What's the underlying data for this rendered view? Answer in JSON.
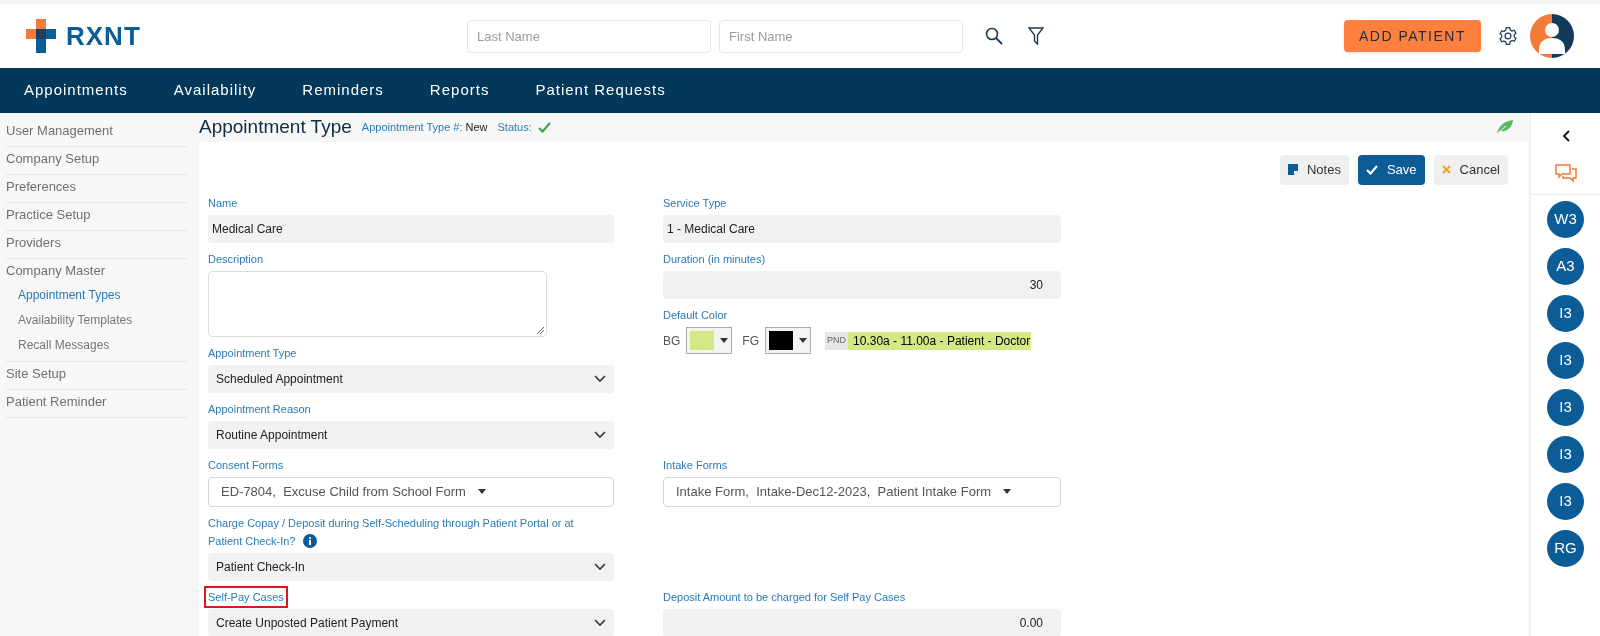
{
  "header": {
    "logo_text": "RXNT",
    "search_fields": [
      {
        "placeholder": "Last Name"
      },
      {
        "placeholder": "First Name"
      }
    ],
    "add_button": "ADD PATIENT"
  },
  "nav": [
    {
      "label": "Appointments"
    },
    {
      "label": "Availability"
    },
    {
      "label": "Reminders"
    },
    {
      "label": "Reports"
    },
    {
      "label": "Patient Requests"
    }
  ],
  "sidebar": [
    {
      "label": "User Management",
      "selected": false
    },
    {
      "label": "Company Setup",
      "selected": false
    },
    {
      "label": "Preferences",
      "selected": false
    },
    {
      "label": "Practice Setup",
      "selected": false
    },
    {
      "label": "Providers",
      "selected": false
    },
    {
      "label": "Company Master",
      "selected": false,
      "children": [
        {
          "label": "Appointment Types",
          "selected": true
        },
        {
          "label": "Availability Templates",
          "selected": false
        },
        {
          "label": "Recall Messages",
          "selected": false
        }
      ]
    },
    {
      "label": "Site Setup",
      "selected": false
    },
    {
      "label": "Patient Reminder",
      "selected": false
    }
  ],
  "page": {
    "title": "Appointment Type",
    "number_label": "Appointment Type #:",
    "number_value": "New",
    "status_label": "Status:"
  },
  "actions": [
    {
      "kind": "notes",
      "label": "Notes"
    },
    {
      "kind": "save",
      "label": "Save"
    },
    {
      "kind": "cancel",
      "label": "Cancel"
    }
  ],
  "left_fields": [
    {
      "kind": "text",
      "label": "Name",
      "value": "Medical Care",
      "highlighted": false,
      "info": false
    },
    {
      "kind": "textarea",
      "label": "Description",
      "highlighted": false,
      "info": false
    },
    {
      "kind": "select",
      "label": "Appointment Type",
      "value": "Scheduled Appointment",
      "highlighted": false,
      "info": false
    },
    {
      "kind": "select",
      "label": "Appointment Reason",
      "value": "Routine Appointment",
      "highlighted": false,
      "info": false
    },
    {
      "kind": "multiselect",
      "label": "Consent Forms",
      "value": "ED-7804,  Excuse Child from School Form",
      "highlighted": false,
      "info": false
    },
    {
      "kind": "select",
      "label": "Charge Copay / Deposit during Self-Scheduling through Patient Portal or at Patient Check-In?",
      "value": "Patient Check-In",
      "highlighted": false,
      "info": true
    },
    {
      "kind": "select",
      "label": "Self-Pay Cases",
      "value": "Create Unposted Patient Payment",
      "highlighted": true,
      "info": false
    }
  ],
  "right_fields": [
    {
      "kind": "text",
      "label": "Service Type",
      "value": "1 - Medical Care"
    },
    {
      "kind": "number",
      "label": "Duration (in minutes)",
      "value": "30"
    },
    {
      "kind": "color",
      "label": "Default Color",
      "pickers": [
        {
          "label": "BG",
          "color": "#d4e884"
        },
        {
          "label": "FG",
          "color": "#000000"
        }
      ],
      "preview_tag": "PND",
      "preview_text": "10.30a - 11.00a - Patient - Doctor"
    },
    {
      "kind": "multiselect",
      "label": "Intake Forms",
      "value": "Intake Form,  Intake-Dec12-2023,  Patient Intake Form"
    },
    {
      "kind": "number",
      "label": "Deposit Amount to be charged for Self Pay Cases",
      "value": "0.00"
    }
  ],
  "rail": [
    {
      "label": "W3"
    },
    {
      "label": "A3"
    },
    {
      "label": "I3"
    },
    {
      "label": "I3"
    },
    {
      "label": "I3"
    },
    {
      "label": "I3"
    },
    {
      "label": "I3"
    },
    {
      "label": "RG"
    }
  ]
}
